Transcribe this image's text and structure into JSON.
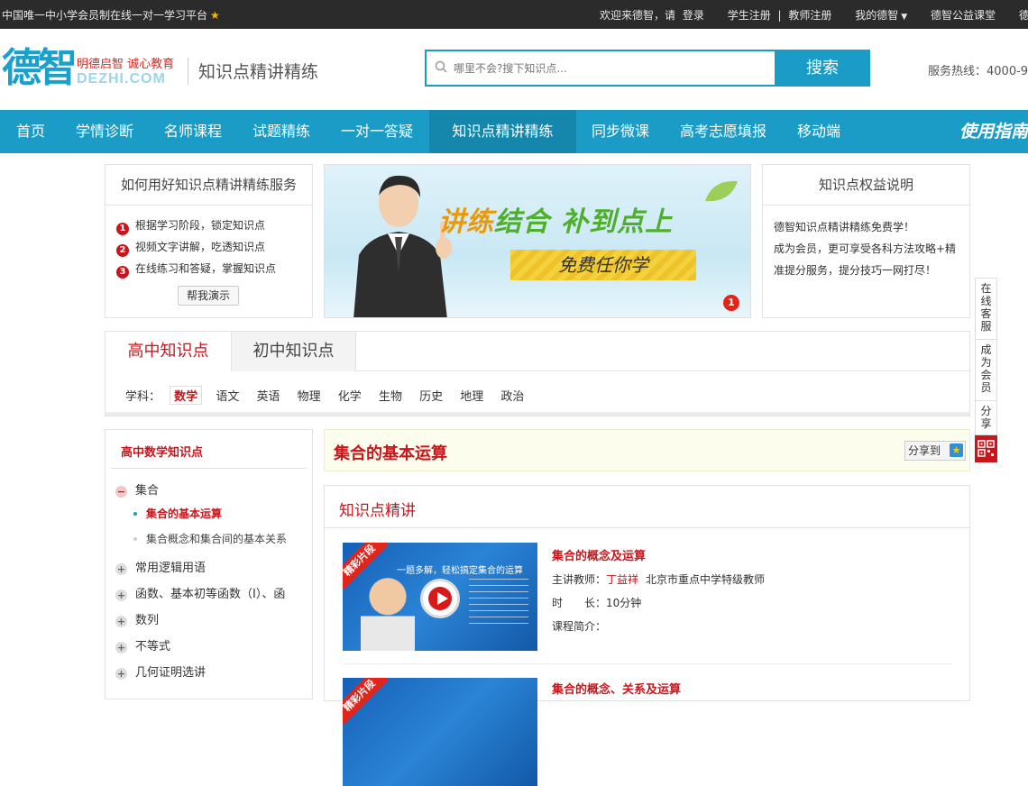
{
  "topbar": {
    "slogan": "中国唯一中小学会员制在线一对一学习平台",
    "welcome": "欢迎来德智，请",
    "login": "登录",
    "student_reg": "学生注册",
    "sep": "|",
    "teacher_reg": "教师注册",
    "my": "我的德智",
    "public": "德智公益课堂",
    "more": "德智"
  },
  "header": {
    "logo": "德智",
    "logo_slogan": "明德启智 诚心教育",
    "logo_en": "DEZHI.COM",
    "page_name": "知识点精讲精练",
    "search_placeholder": "哪里不会?搜下知识点...",
    "search_button": "搜索",
    "hotline": "服务热线：4000-9"
  },
  "nav": {
    "items": [
      "首页",
      "学情诊断",
      "名师课程",
      "试题精练",
      "一对一答疑",
      "知识点精讲精练",
      "同步微课",
      "高考志愿填报",
      "移动端"
    ],
    "guide": "使用指南"
  },
  "howto": {
    "title": "如何用好知识点精讲精练服务",
    "steps": [
      {
        "num": "1",
        "text": "根据学习阶段，锁定知识点"
      },
      {
        "num": "2",
        "text": "视频文字讲解，吃透知识点"
      },
      {
        "num": "3",
        "text": "在线练习和答疑，掌握知识点"
      }
    ],
    "demo_button": "帮我演示"
  },
  "banner": {
    "title_a": "讲练",
    "title_b": "结合",
    "title_c": "补到点上",
    "subtitle": "免费任你学",
    "dot": "1"
  },
  "rights": {
    "title": "知识点权益说明",
    "line1": "德智知识点精讲精练免费学！",
    "line2": "成为会员，更可享受各科方法攻略+精准提分服务，提分技巧一网打尽！"
  },
  "tabs": {
    "high": "高中知识点",
    "middle": "初中知识点",
    "subject_label": "学科：",
    "subjects": [
      "数学",
      "语文",
      "英语",
      "物理",
      "化学",
      "生物",
      "历史",
      "地理",
      "政治"
    ]
  },
  "tree": {
    "title": "高中数学知识点",
    "nodes": [
      {
        "icon": "−",
        "label": "集合"
      },
      {
        "icon": "+",
        "label": "常用逻辑用语"
      },
      {
        "icon": "+",
        "label": "函数、基本初等函数（I）、函"
      },
      {
        "icon": "+",
        "label": "数列"
      },
      {
        "icon": "+",
        "label": "不等式"
      },
      {
        "icon": "+",
        "label": "几何证明选讲"
      }
    ],
    "leaves": [
      "集合的基本运算",
      "集合概念和集合间的基本关系"
    ]
  },
  "topic": {
    "title": "集合的基本运算",
    "share": "分享到"
  },
  "content": {
    "section_title": "知识点精讲",
    "video_tag": "精彩片段",
    "video_text": "一题多解，轻松搞定集合的运算",
    "lessons": [
      {
        "title": "集合的概念及运算",
        "teacher_label": "主讲教师：",
        "teacher": "丁益祥",
        "teacher_desc": "北京市重点中学特级教师",
        "duration_label": "时　　长：",
        "duration": "10分钟",
        "intro_label": "课程简介："
      },
      {
        "title": "集合的概念、关系及运算"
      }
    ]
  },
  "float": {
    "service": "在线客服",
    "member": "成为会员",
    "share": "分享"
  }
}
